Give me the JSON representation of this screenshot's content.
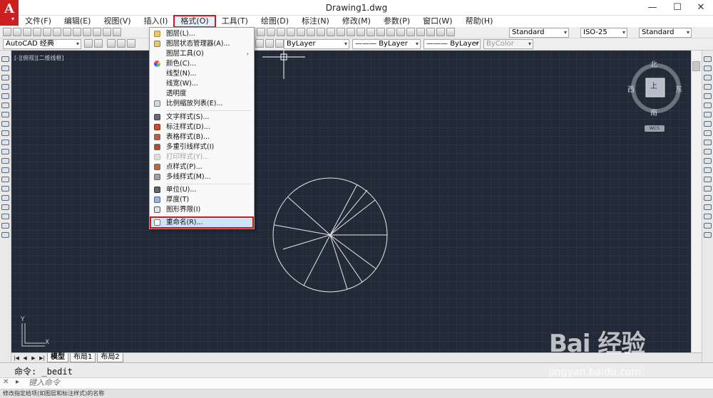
{
  "window": {
    "title": "Drawing1.dwg",
    "logo_letter": "A",
    "min": "—",
    "max": "☐",
    "close": "✕"
  },
  "menubar": [
    "文件(F)",
    "编辑(E)",
    "视图(V)",
    "插入(I)",
    "格式(O)",
    "工具(T)",
    "绘图(D)",
    "标注(N)",
    "修改(M)",
    "参数(P)",
    "窗口(W)",
    "帮助(H)"
  ],
  "toolbar": {
    "workspace": "AutoCAD 经典",
    "text_style": "Standard",
    "dim_style": "ISO-25",
    "table_style": "Standard",
    "layer_color": "ByLayer",
    "linetype": "ByLayer",
    "lineweight": "ByLayer",
    "plot_style": "ByColor"
  },
  "canvas": {
    "view_label": "[-][俯视][二维线框]",
    "ucs_y": "Y",
    "ucs_x": "X"
  },
  "compass": {
    "north": "北",
    "south": "南",
    "east": "东",
    "west": "西",
    "top": "上",
    "wcs": "WCS"
  },
  "format_menu": {
    "items": [
      {
        "label": "图层(L)...",
        "icon": "layer-icon"
      },
      {
        "label": "图层状态管理器(A)...",
        "icon": "layer-state-icon"
      },
      {
        "label": "图层工具(O)",
        "icon": "",
        "submenu": "›"
      },
      {
        "label": "颜色(C)...",
        "icon": "color-wheel-icon"
      },
      {
        "label": "线型(N)...",
        "icon": ""
      },
      {
        "label": "线宽(W)...",
        "icon": ""
      },
      {
        "label": "透明度",
        "icon": ""
      },
      {
        "label": "比例缩放列表(E)...",
        "icon": "scale-list-icon"
      },
      {
        "label": "文字样式(S)...",
        "icon": "text-style-icon"
      },
      {
        "label": "标注样式(D)...",
        "icon": "dim-style-icon"
      },
      {
        "label": "表格样式(B)...",
        "icon": "table-style-icon"
      },
      {
        "label": "多重引线样式(I)",
        "icon": "mleader-style-icon"
      },
      {
        "label": "打印样式(Y)...",
        "icon": "plot-style-icon"
      },
      {
        "label": "点样式(P)...",
        "icon": "point-style-icon"
      },
      {
        "label": "多线样式(M)...",
        "icon": "mline-style-icon"
      },
      {
        "label": "单位(U)...",
        "icon": "units-icon"
      },
      {
        "label": "厚度(T)",
        "icon": "thickness-icon"
      },
      {
        "label": "图形界限(I)",
        "icon": "limits-icon"
      },
      {
        "label": "重命名(R)...",
        "icon": "rename-icon"
      }
    ]
  },
  "tabs": [
    "模型",
    "布局1",
    "布局2"
  ],
  "tab_nav": [
    "|◀",
    "◀",
    "▶",
    "▶|"
  ],
  "command": {
    "history": "命令: _bedit",
    "placeholder": "键入命令",
    "close": "✕",
    "prompt_icon": "▸"
  },
  "status": {
    "text": "修改指定给项(如图层和标注样式)的名称"
  },
  "watermark": {
    "brand": "Bai 经验",
    "url": "jingyan.baidu.com"
  }
}
